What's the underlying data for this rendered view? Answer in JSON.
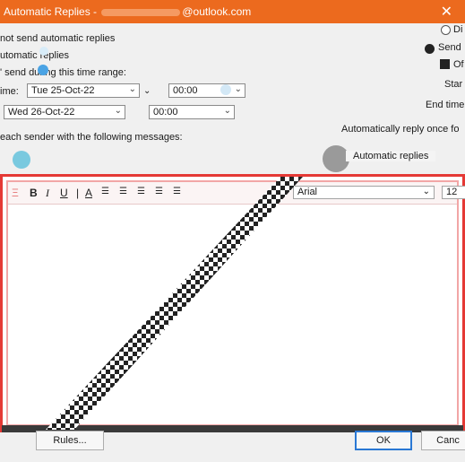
{
  "window": {
    "title_prefix": "Automatic Replies - ",
    "title_suffix": "@outlook.com"
  },
  "options": {
    "no_auto": "not send automatic replies",
    "send_auto": "utomatic replies",
    "only_range": "' send during this time range:",
    "start_time_label": "ime:",
    "start_date": "Tue 25-Oct-22",
    "start_clock": "00:00",
    "end_date": "Wed 26-Oct-22",
    "end_clock": "00:00",
    "message_label": "each sender with the following messages:"
  },
  "right_panel": {
    "radio_top": "Di",
    "radio_send": "Send",
    "radio_only": "Of",
    "start_label": "Star",
    "end_label": "End time",
    "auto_once": "Automatically reply once fo",
    "auto_replies_tag": "Automatic replies"
  },
  "editor": {
    "font_name": "Arial",
    "font_size": "12"
  },
  "buttons": {
    "rules": "Rules...",
    "ok": "OK",
    "cancel": "Canc"
  }
}
